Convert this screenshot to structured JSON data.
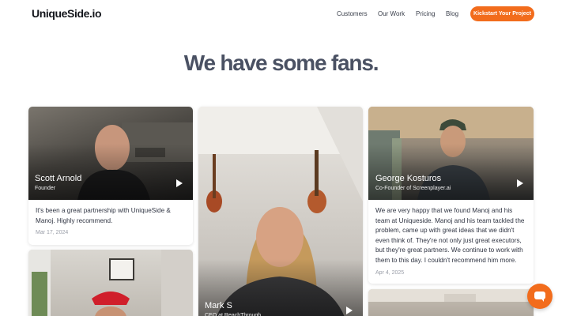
{
  "header": {
    "logo": "UniqueSide.io",
    "nav": [
      "Customers",
      "Our Work",
      "Pricing",
      "Blog"
    ],
    "cta": "Kickstart Your Project"
  },
  "headline": "We have some fans.",
  "testimonials": [
    {
      "name": "Scott Arnold",
      "role": "Founder",
      "quote_lines": [
        "It's been a great partnership with UniqueSide &",
        "Manoj. Highly recommend."
      ],
      "date": "Mar 17, 2024"
    },
    {
      "name": "Mark S",
      "role": "CEO at ReachThrough"
    },
    {
      "name": "George Kosturos",
      "role": "Co-Founder of Screenplayer.ai",
      "quote_lines": [
        "We are very happy that we found Manoj and his",
        "team at Uniqueside. Manoj and his team tackled the",
        "problem, came up with great ideas that we didn't",
        "even think of. They're not only just great executors,",
        "but they're great partners. We continue to work with",
        "them to this day. I couldn't recommend him more."
      ],
      "date": "Apr 4, 2025"
    }
  ],
  "colors": {
    "accent": "#f26c1c",
    "headline": "#4a5163"
  },
  "icons": {
    "play": "play-icon",
    "chat": "chat-icon"
  }
}
